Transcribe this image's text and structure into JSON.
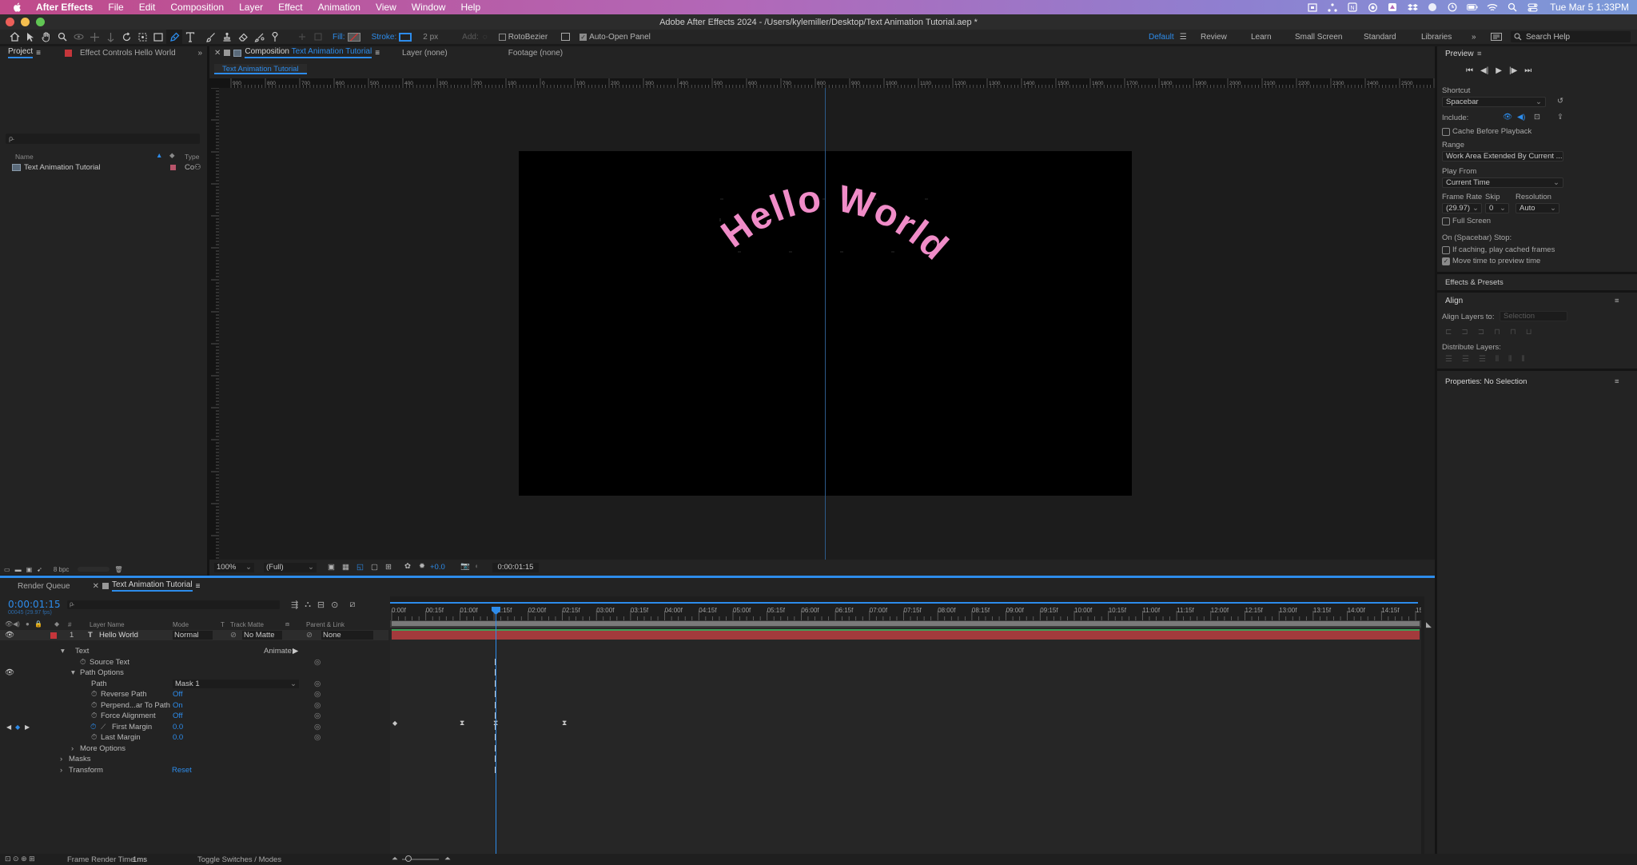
{
  "menubar": {
    "app_name": "After Effects",
    "items": [
      "File",
      "Edit",
      "Composition",
      "Layer",
      "Effect",
      "Animation",
      "View",
      "Window",
      "Help"
    ],
    "clock": "Tue Mar 5  1:33PM"
  },
  "window": {
    "title": "Adobe After Effects 2024 - /Users/kylemiller/Desktop/Text Animation Tutorial.aep *"
  },
  "toolbar": {
    "fill_label": "Fill:",
    "stroke_label": "Stroke:",
    "stroke_width": "2 px",
    "add_label": "Add:",
    "rotobezier_label": "RotoBezier",
    "auto_open_label": "Auto-Open Panel",
    "workspaces": [
      "Default",
      "Review",
      "Learn",
      "Small Screen",
      "Standard",
      "Libraries"
    ],
    "search_placeholder": "Search Help"
  },
  "project_panel": {
    "tab_project": "Project",
    "tab_effect_controls": "Effect Controls Hello World",
    "search_placeholder": "ρ̵",
    "col_name": "Name",
    "col_type": "Type",
    "item_name": "Text Animation Tutorial",
    "item_type": "Co",
    "bpc": "8 bpc"
  },
  "comp_panel": {
    "tab_prefix": "Composition",
    "tab_comp_name": "Text Animation Tutorial",
    "tab_layer": "Layer (none)",
    "tab_footage": "Footage (none)",
    "subtab": "Text Animation Tutorial",
    "ruler_labels": [
      "900",
      "800",
      "700",
      "600",
      "500",
      "400",
      "300",
      "200",
      "100",
      "0",
      "100",
      "200",
      "300",
      "400",
      "500",
      "600",
      "700",
      "800",
      "900",
      "1000",
      "1100",
      "1200",
      "1300",
      "1400",
      "1500",
      "1600",
      "1700",
      "1800",
      "1900",
      "2000",
      "2100",
      "2200",
      "2300",
      "2400",
      "2500",
      "2600",
      "2700",
      "2800"
    ],
    "canvas_text": "Hello World",
    "text_color": "#f08cc8",
    "zoom": "100%",
    "resolution": "(Full)",
    "exposure": "+0.0",
    "timecode": "0:00:01:15"
  },
  "timeline": {
    "tab_render_queue": "Render Queue",
    "tab_comp": "Text Animation Tutorial",
    "current_time": "0:00:01:15",
    "fps_info": "00045 (29.97 fps)",
    "col_layer_name": "Layer Name",
    "col_mode": "Mode",
    "col_t": "T",
    "col_track_matte": "Track Matte",
    "col_parent": "Parent & Link",
    "layer_index": "1",
    "layer_name": "Hello World",
    "layer_mode": "Normal",
    "layer_matte": "No Matte",
    "layer_parent": "None",
    "animate_label": "Animate:",
    "rows": {
      "text": "Text",
      "source_text": "Source Text",
      "path_options": "Path Options",
      "path": "Path",
      "path_value": "Mask 1",
      "reverse_path": "Reverse Path",
      "reverse_path_value": "Off",
      "perpendicular": "Perpend...ar To Path",
      "perpendicular_value": "On",
      "force_alignment": "Force Alignment",
      "force_alignment_value": "Off",
      "first_margin": "First Margin",
      "first_margin_value": "0.0",
      "last_margin": "Last Margin",
      "last_margin_value": "0.0",
      "more_options": "More Options",
      "masks": "Masks",
      "transform": "Transform",
      "transform_value": "Reset"
    },
    "ruler_labels": [
      "0:00f",
      "00:15f",
      "01:00f",
      "01:15f",
      "02:00f",
      "02:15f",
      "03:00f",
      "03:15f",
      "04:00f",
      "04:15f",
      "05:00f",
      "05:15f",
      "06:00f",
      "06:15f",
      "07:00f",
      "07:15f",
      "08:00f",
      "08:15f",
      "09:00f",
      "09:15f",
      "10:00f",
      "10:15f",
      "11:00f",
      "11:15f",
      "12:00f",
      "12:15f",
      "13:00f",
      "13:15f",
      "14:00f",
      "14:15f",
      "15:0"
    ],
    "frame_render_label": "Frame Render Time",
    "frame_render_value": "1ms",
    "toggle_label": "Toggle Switches / Modes"
  },
  "preview_panel": {
    "title": "Preview",
    "shortcut_label": "Shortcut",
    "shortcut_value": "Spacebar",
    "include_label": "Include:",
    "cache_label": "Cache Before Playback",
    "range_label": "Range",
    "range_value": "Work Area Extended By Current ...",
    "play_from_label": "Play From",
    "play_from_value": "Current Time",
    "frame_rate_label": "Frame Rate",
    "skip_label": "Skip",
    "resolution_label": "Resolution",
    "frame_rate_value": "(29.97)",
    "skip_value": "0",
    "resolution_value": "Auto",
    "full_screen_label": "Full Screen",
    "stop_label": "On (Spacebar) Stop:",
    "if_caching_label": "If caching, play cached frames",
    "move_time_label": "Move time to preview time"
  },
  "effects_presets": {
    "title": "Effects & Presets"
  },
  "align_panel": {
    "title": "Align",
    "align_to_label": "Align Layers to:",
    "align_to_value": "Selection",
    "distribute_label": "Distribute Layers:"
  },
  "properties_panel": {
    "title": "Properties: No Selection"
  }
}
